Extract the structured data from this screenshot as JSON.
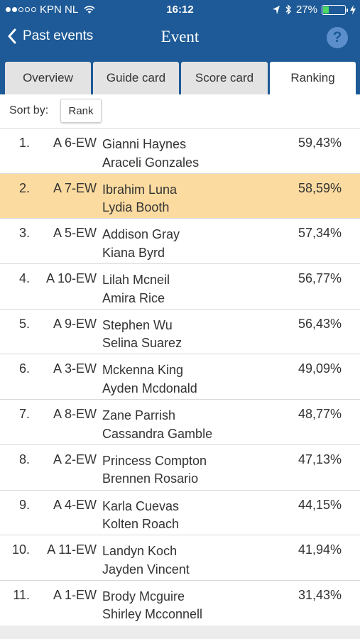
{
  "status": {
    "carrier": "KPN NL",
    "time": "16:12",
    "battery": "27%",
    "battery_level": 0.27
  },
  "nav": {
    "back_label": "Past events",
    "title": "Event",
    "help_label": "?"
  },
  "tabs": [
    {
      "label": "Overview",
      "active": false
    },
    {
      "label": "Guide card",
      "active": false
    },
    {
      "label": "Score card",
      "active": false
    },
    {
      "label": "Ranking",
      "active": true
    }
  ],
  "sort": {
    "label": "Sort by:",
    "value": "Rank"
  },
  "rows": [
    {
      "rank": "1.",
      "pair": "A 6-EW",
      "player1": "Gianni Haynes",
      "player2": "Araceli Gonzales",
      "score": "59,43%"
    },
    {
      "rank": "2.",
      "pair": "A 7-EW",
      "player1": "Ibrahim Luna",
      "player2": "Lydia Booth",
      "score": "58,59%",
      "highlight": true
    },
    {
      "rank": "3.",
      "pair": "A 5-EW",
      "player1": "Addison Gray",
      "player2": "Kiana Byrd",
      "score": "57,34%"
    },
    {
      "rank": "4.",
      "pair": "A 10-EW",
      "player1": "Lilah Mcneil",
      "player2": "Amira Rice",
      "score": "56,77%"
    },
    {
      "rank": "5.",
      "pair": "A 9-EW",
      "player1": "Stephen Wu",
      "player2": "Selina Suarez",
      "score": "56,43%"
    },
    {
      "rank": "6.",
      "pair": "A 3-EW",
      "player1": "Mckenna King",
      "player2": "Ayden Mcdonald",
      "score": "49,09%"
    },
    {
      "rank": "7.",
      "pair": "A 8-EW",
      "player1": "Zane Parrish",
      "player2": "Cassandra Gamble",
      "score": "48,77%"
    },
    {
      "rank": "8.",
      "pair": "A 2-EW",
      "player1": "Princess Compton",
      "player2": "Brennen Rosario",
      "score": "47,13%"
    },
    {
      "rank": "9.",
      "pair": "A 4-EW",
      "player1": "Karla Cuevas",
      "player2": "Kolten Roach",
      "score": "44,15%"
    },
    {
      "rank": "10.",
      "pair": "A 11-EW",
      "player1": "Landyn Koch",
      "player2": "Jayden Vincent",
      "score": "41,94%"
    },
    {
      "rank": "11.",
      "pair": "A 1-EW",
      "player1": "Brody Mcguire",
      "player2": "Shirley Mcconnell",
      "score": "31,43%"
    }
  ]
}
